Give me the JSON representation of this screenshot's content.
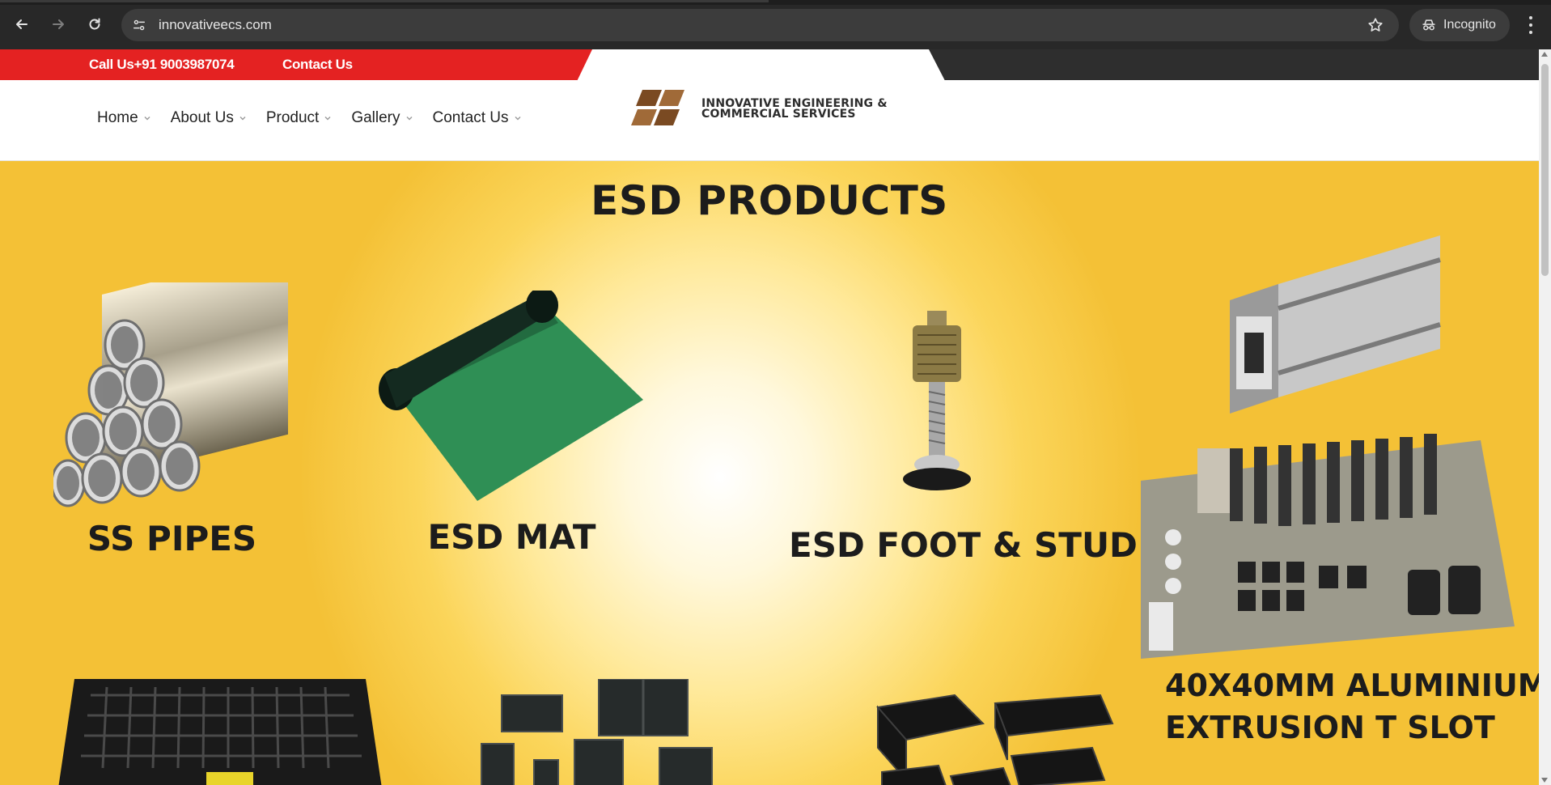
{
  "browser": {
    "url": "innovativeecs.com",
    "mode_label": "Incognito"
  },
  "topbar": {
    "call_text": "Call Us+91 9003987074",
    "contact_label": "Contact Us",
    "accent_color": "#e42222"
  },
  "nav": {
    "items": [
      {
        "label": "Home"
      },
      {
        "label": "About Us"
      },
      {
        "label": "Product"
      },
      {
        "label": "Gallery"
      },
      {
        "label": "Contact Us"
      }
    ]
  },
  "logo": {
    "line1": "INNOVATIVE ENGINEERING &",
    "line2": "COMMERCIAL SERVICES"
  },
  "hero": {
    "title": "ESD PRODUCTS",
    "products": [
      {
        "caption": "SS PIPES",
        "icon": "steel-pipes-image"
      },
      {
        "caption": "ESD MAT",
        "icon": "esd-mat-roll-image"
      },
      {
        "caption": "ESD FOOT & STUD",
        "icon": "esd-foot-stud-image"
      },
      {
        "caption_line1": "40X40MM ALUMINIUM",
        "caption_line2": "EXTRUSION T SLOT",
        "icon": "aluminium-extrusion-image"
      },
      {
        "caption": "",
        "icon": "esd-grid-tray-image"
      },
      {
        "caption": "",
        "icon": "esd-bins-image"
      },
      {
        "caption": "",
        "icon": "esd-boxes-image"
      }
    ]
  }
}
